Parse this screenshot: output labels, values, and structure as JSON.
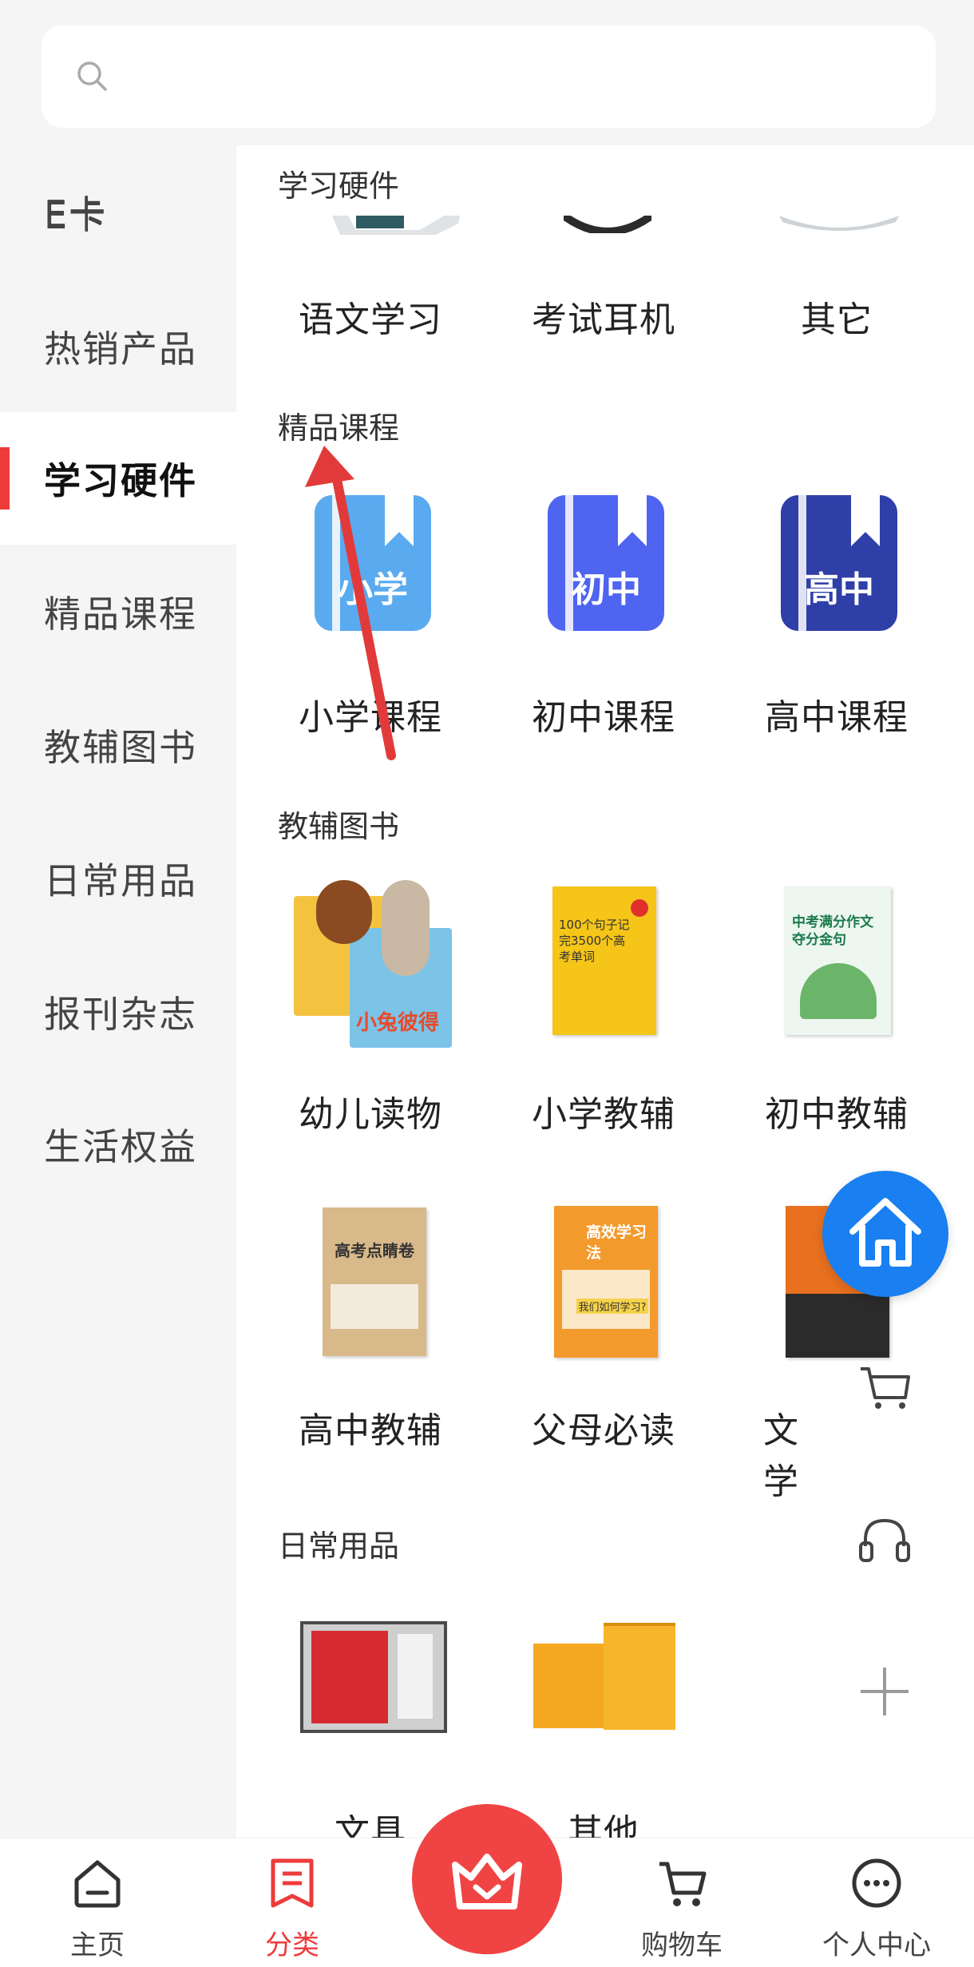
{
  "search": {
    "placeholder": ""
  },
  "sidebar": {
    "items": [
      {
        "label": "E卡"
      },
      {
        "label": "热销产品"
      },
      {
        "label": "学习硬件"
      },
      {
        "label": "精品课程"
      },
      {
        "label": "教辅图书"
      },
      {
        "label": "日常用品"
      },
      {
        "label": "报刊杂志"
      },
      {
        "label": "生活权益"
      }
    ],
    "active_index": 2
  },
  "sections": {
    "hardware": {
      "title": "学习硬件",
      "items": [
        "语文学习",
        "考试耳机",
        "其它"
      ]
    },
    "courses": {
      "title": "精品课程",
      "items": [
        {
          "label": "小学课程",
          "icon_text": "小学",
          "color": "#5aaaf0"
        },
        {
          "label": "初中课程",
          "icon_text": "初中",
          "color": "#4f64f0"
        },
        {
          "label": "高中课程",
          "icon_text": "高中",
          "color": "#2e3fa8"
        }
      ]
    },
    "books": {
      "title": "教辅图书",
      "items": [
        "幼儿读物",
        "小学教辅",
        "初中教辅",
        "高中教辅",
        "父母必读",
        "文学"
      ],
      "cover_texts": {
        "kids": "小兔彼得",
        "primary": "100个句子记完3500个高考单词",
        "middle": "中考满分作文夺分金句",
        "high": "高考点睛卷",
        "parents": "高效学习法",
        "parents_sub": "我们如何学习?"
      }
    },
    "daily": {
      "title": "日常用品",
      "items": [
        "文具",
        "其他"
      ]
    }
  },
  "bottom_nav": {
    "items": [
      {
        "label": "主页"
      },
      {
        "label": "分类"
      },
      {
        "label": "购物车"
      },
      {
        "label": "个人中心"
      }
    ],
    "active_index": 1
  },
  "colors": {
    "accent": "#ee3b3b",
    "float_home": "#1a7ff0"
  }
}
